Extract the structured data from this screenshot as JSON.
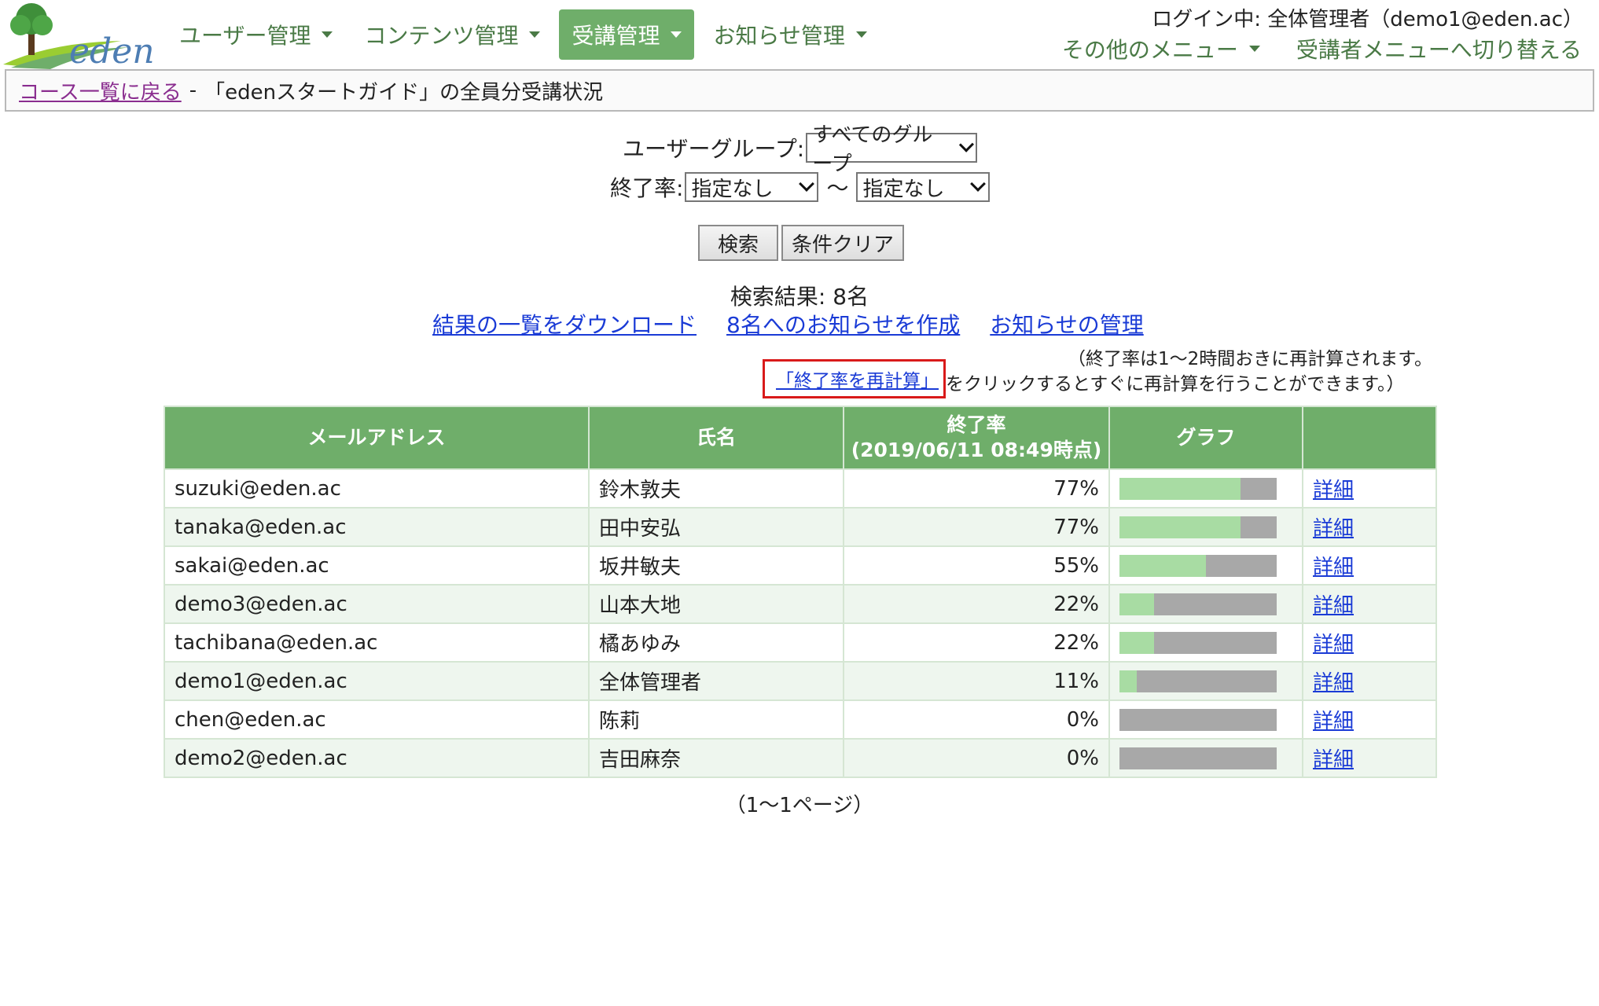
{
  "header": {
    "logo_text": "eden",
    "nav": [
      {
        "label": "ユーザー管理",
        "active": false
      },
      {
        "label": "コンテンツ管理",
        "active": false
      },
      {
        "label": "受講管理",
        "active": true
      },
      {
        "label": "お知らせ管理",
        "active": false
      }
    ],
    "login_info": "ログイン中: 全体管理者（demo1@eden.ac）",
    "other_menu": "その他のメニュー",
    "switch_menu": "受講者メニューへ切り替える"
  },
  "breadcrumb": {
    "back_link": "コース一覧に戻る",
    "separator": "-",
    "title": "「edenスタートガイド」の全員分受講状況"
  },
  "search": {
    "group_label": "ユーザーグループ:",
    "group_value": "すべてのグループ",
    "rate_label": "終了率:",
    "rate_from": "指定なし",
    "tilde": "～",
    "rate_to": "指定なし",
    "search_button": "検索",
    "clear_button": "条件クリア"
  },
  "results": {
    "count_text": "検索結果: 8名",
    "download_link": "結果の一覧をダウンロード",
    "notice_link": "8名へのお知らせを作成",
    "manage_link": "お知らせの管理",
    "note_line1": "（終了率は1～2時間おきに再計算されます。",
    "recalc_link": "「終了率を再計算」",
    "note_line2": "をクリックするとすぐに再計算を行うことができます。）"
  },
  "table": {
    "headers": {
      "email": "メールアドレス",
      "name": "氏名",
      "rate_line1": "終了率",
      "rate_line2": "(2019/06/11 08:49時点)",
      "graph": "グラフ",
      "detail": ""
    },
    "rows": [
      {
        "email": "suzuki@eden.ac",
        "name": "鈴木敦夫",
        "rate": "77%",
        "rate_value": 0.77,
        "detail": "詳細"
      },
      {
        "email": "tanaka@eden.ac",
        "name": "田中安弘",
        "rate": "77%",
        "rate_value": 0.77,
        "detail": "詳細"
      },
      {
        "email": "sakai@eden.ac",
        "name": "坂井敏夫",
        "rate": "55%",
        "rate_value": 0.55,
        "detail": "詳細"
      },
      {
        "email": "demo3@eden.ac",
        "name": "山本大地",
        "rate": "22%",
        "rate_value": 0.22,
        "detail": "詳細"
      },
      {
        "email": "tachibana@eden.ac",
        "name": "橘あゆみ",
        "rate": "22%",
        "rate_value": 0.22,
        "detail": "詳細"
      },
      {
        "email": "demo1@eden.ac",
        "name": "全体管理者",
        "rate": "11%",
        "rate_value": 0.11,
        "detail": "詳細"
      },
      {
        "email": "chen@eden.ac",
        "name": "陈莉",
        "rate": "0%",
        "rate_value": 0,
        "detail": "詳細"
      },
      {
        "email": "demo2@eden.ac",
        "name": "吉田麻奈",
        "rate": "0%",
        "rate_value": 0,
        "detail": "詳細"
      }
    ]
  },
  "pager": "（1～1ページ）",
  "colors": {
    "accent_green": "#6fae6a",
    "bar_fill": "#a8dca3",
    "bar_track": "#a8a8a8",
    "link_blue": "#1a3bd6",
    "highlight_red": "#d91a1a"
  }
}
